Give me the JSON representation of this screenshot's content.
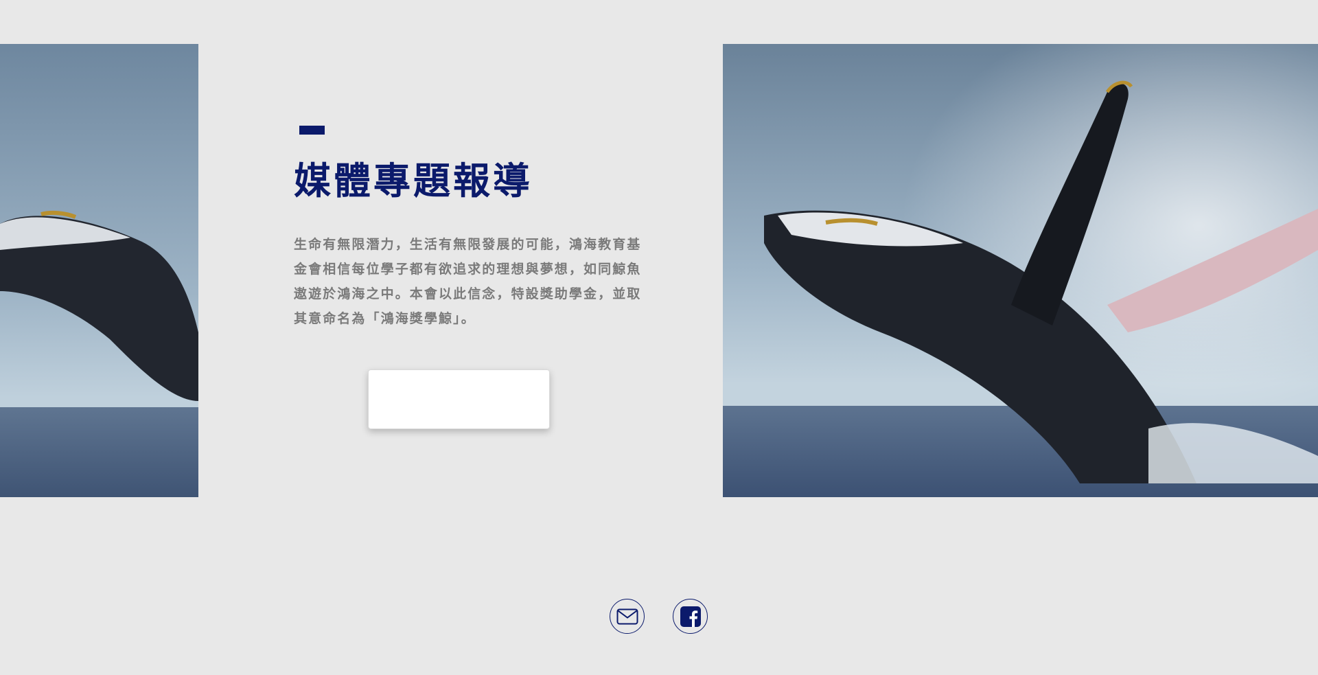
{
  "hero": {
    "title": "媒體專題報導",
    "description": "生命有無限潛力，生活有無限發展的可能，鴻海教育基金會相信每位學子都有欲追求的理想與夢想，如同鯨魚遨遊於鴻海之中。本會以此信念，特設獎助學金，並取其意命名為「鴻海獎學鯨」。",
    "button_label": ""
  },
  "images": {
    "left": "humpback-whale-breaching-photo",
    "right": "humpback-whale-breaching-photo"
  },
  "footer": {
    "icons": [
      "mail-icon",
      "facebook-icon"
    ]
  },
  "colors": {
    "brand": "#0b1a6b",
    "background": "#e8e8e8",
    "body_text": "#7a7a7a"
  }
}
